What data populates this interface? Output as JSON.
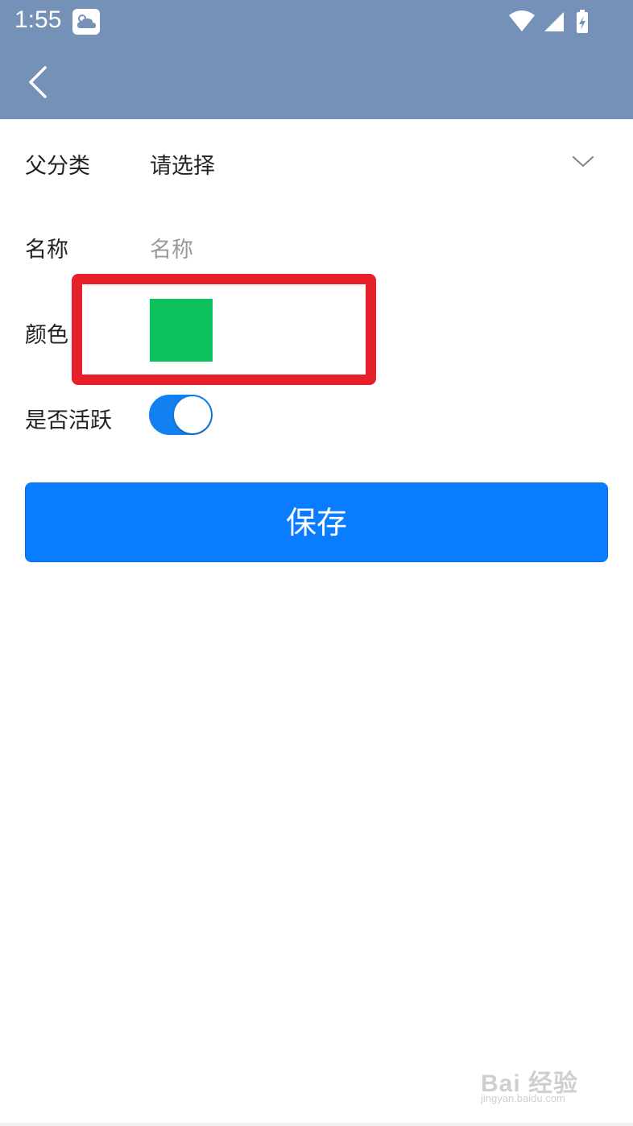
{
  "status_bar": {
    "time": "1:55",
    "weather_icon": "cloud-sun-icon",
    "wifi_icon": "wifi-icon",
    "signal_icon": "cell-signal-icon",
    "battery_icon": "battery-charging-icon"
  },
  "app_bar": {
    "back_icon": "chevron-left-icon",
    "background_color": "#7591b7"
  },
  "form": {
    "parent_category": {
      "label": "父分类",
      "value": "请选择",
      "dropdown_icon": "chevron-down-icon"
    },
    "name": {
      "label": "名称",
      "placeholder": "名称",
      "value": ""
    },
    "color": {
      "label": "颜色",
      "value": "#0dc25c"
    },
    "active": {
      "label": "是否活跃",
      "checked": true,
      "on_color": "#1280f0"
    },
    "save_label": "保存",
    "save_color": "#0a7cff"
  },
  "annotation": {
    "highlight_color": "#e6202a"
  },
  "watermark": {
    "main": "Bai 经验",
    "sub": "jingyan.baidu.com"
  }
}
